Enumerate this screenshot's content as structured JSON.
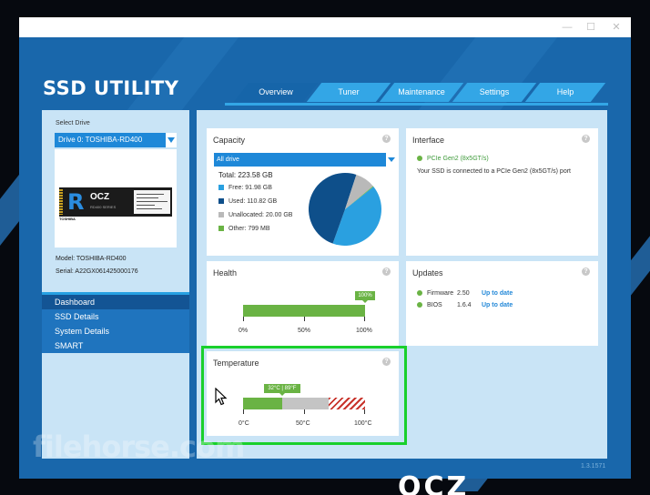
{
  "window": {
    "controls": {
      "minimize": "—",
      "maximize": "☐",
      "close": "✕"
    }
  },
  "app": {
    "title": "SSD UTILITY",
    "version": "1.3.1571"
  },
  "tabs": [
    {
      "label": "Overview",
      "active": true
    },
    {
      "label": "Tuner",
      "active": false
    },
    {
      "label": "Maintenance",
      "active": false
    },
    {
      "label": "Settings",
      "active": false
    },
    {
      "label": "Help",
      "active": false
    }
  ],
  "sidebar": {
    "select_label": "Select Drive",
    "selected_drive": "Drive 0: TOSHIBA-RD400",
    "ssd_image": {
      "brand": "OCZ",
      "subtitle": "RD400 SERIES",
      "maker": "TOSHIBA"
    },
    "model": "Model: TOSHIBA-RD400",
    "serial": "Serial: A22GX061425000176",
    "nav": [
      {
        "label": "Dashboard",
        "active": true
      },
      {
        "label": "SSD Details",
        "active": false
      },
      {
        "label": "System Details",
        "active": false
      },
      {
        "label": "SMART",
        "active": false
      }
    ]
  },
  "capacity": {
    "title": "Capacity",
    "help": "?",
    "selector": "All drive",
    "total": "Total: 223.58 GB",
    "legend": [
      {
        "label": "Free: 91.98 GB",
        "color": "#2aa0e0",
        "value": 91.98
      },
      {
        "label": "Used: 110.82 GB",
        "color": "#0e4f8a",
        "value": 110.82
      },
      {
        "label": "Unallocated: 20.00 GB",
        "color": "#b9b9b9",
        "value": 20.0
      },
      {
        "label": "Other: 799 MB",
        "color": "#6ab344",
        "value": 0.78
      }
    ]
  },
  "interface": {
    "title": "Interface",
    "help": "?",
    "link": "PCIe Gen2 (8x5GT/s)",
    "description": "Your SSD is connected to a PCIe Gen2 (8x5GT/s) port"
  },
  "health": {
    "title": "Health",
    "help": "?",
    "value": 100,
    "badge": "100%",
    "scale": [
      "0%",
      "50%",
      "100%"
    ]
  },
  "updates": {
    "title": "Updates",
    "help": "?",
    "items": [
      {
        "name": "Firmware",
        "version": "2.50",
        "status": "Up to date"
      },
      {
        "name": "BIOS",
        "version": "1.6.4",
        "status": "Up to date"
      }
    ]
  },
  "temperature": {
    "title": "Temperature",
    "help": "?",
    "value": 32,
    "badge": "32°C | 89°F",
    "scale": [
      "0°C",
      "50°C",
      "100°C"
    ],
    "safe_max": 70
  },
  "watermarks": {
    "filehorse": "filehorse.com",
    "ocz": "OCZ"
  }
}
